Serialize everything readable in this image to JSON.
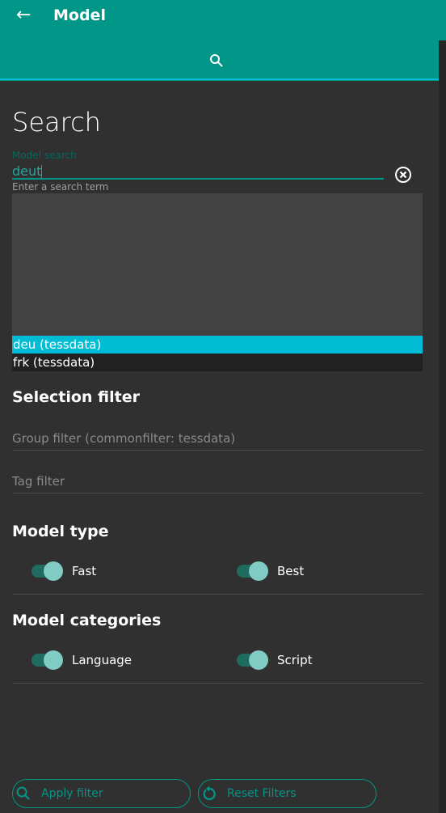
{
  "appbar": {
    "title": "Model",
    "back_icon": "arrow-left-icon",
    "tab_icon": "search-icon"
  },
  "search": {
    "heading": "Search",
    "label": "Model search",
    "value": "deut",
    "helper": "Enter a search term",
    "options": [
      "deu (tessdata)",
      "frk (tessdata)"
    ],
    "selected": "deu (tessdata)"
  },
  "selection_filter": {
    "heading": "Selection filter",
    "group_placeholder": "Group filter (commonfilter: tessdata)",
    "tag_placeholder": "Tag filter"
  },
  "model_type": {
    "heading": "Model type",
    "toggles": [
      {
        "label": "Fast",
        "on": true
      },
      {
        "label": "Best",
        "on": true
      }
    ]
  },
  "model_categories": {
    "heading": "Model categories",
    "toggles": [
      {
        "label": "Language",
        "on": true
      },
      {
        "label": "Script",
        "on": true
      }
    ]
  },
  "buttons": {
    "apply": "Apply filter",
    "reset": "Reset Filters"
  },
  "colors": {
    "primary": "#009688",
    "highlight": "#00bcd4",
    "background": "#303030"
  }
}
